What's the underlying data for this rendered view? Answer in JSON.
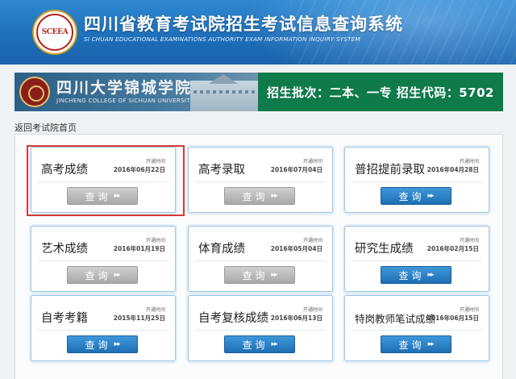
{
  "header": {
    "logo_text": "SCEEA",
    "title": "四川省教育考试院招生考试信息查询系统",
    "subtitle": "SI CHUAN EDUCATIONAL EXAMINATIONS AUTHORITY EXAM INFORMATION INQUIRY SYSTEM"
  },
  "banner": {
    "college_cn": "四川大学锦城学院",
    "college_en": "JINCHENG COLLEGE OF SICHUAN UNIVERSITY",
    "info": "招生批次：二本、一专  招生代码：5702"
  },
  "back_link": "返回考试院首页",
  "cards": [
    {
      "title": "高考成绩",
      "open_label": "开通时间",
      "open_date": "2016年06月22日",
      "button": "查询",
      "button_style": "gray",
      "highlighted": true
    },
    {
      "title": "高考录取",
      "open_label": "开通时间",
      "open_date": "2016年07月04日",
      "button": "查询",
      "button_style": "gray"
    },
    {
      "title": "普招提前录取",
      "open_label": "开通时间",
      "open_date": "2016年04月28日",
      "button": "查询",
      "button_style": "blue"
    },
    {
      "title": "艺术成绩",
      "open_label": "开通时间",
      "open_date": "2016年01月19日",
      "button": "查询",
      "button_style": "gray"
    },
    {
      "title": "体育成绩",
      "open_label": "开通时间",
      "open_date": "2016年05月04日",
      "button": "查询",
      "button_style": "gray"
    },
    {
      "title": "研究生成绩",
      "open_label": "开通时间",
      "open_date": "2016年02月15日",
      "button": "查询",
      "button_style": "blue"
    },
    {
      "title": "自考考籍",
      "open_label": "开通时间",
      "open_date": "2015年11月25日",
      "button": "查询",
      "button_style": "blue"
    },
    {
      "title": "自考复核成绩",
      "open_label": "开通时间",
      "open_date": "2016年06月13日",
      "button": "查询",
      "button_style": "blue"
    },
    {
      "title": "特岗教师笔试成绩",
      "open_label": "开通时间",
      "open_date": "2016年06月15日",
      "button": "查询",
      "button_style": "blue"
    }
  ],
  "colors": {
    "header": "#1f6fba",
    "banner_green": "#0f7a4a",
    "button_blue": "#1e6fb4",
    "button_gray": "#a8a8a8",
    "highlight": "#d33a34"
  }
}
